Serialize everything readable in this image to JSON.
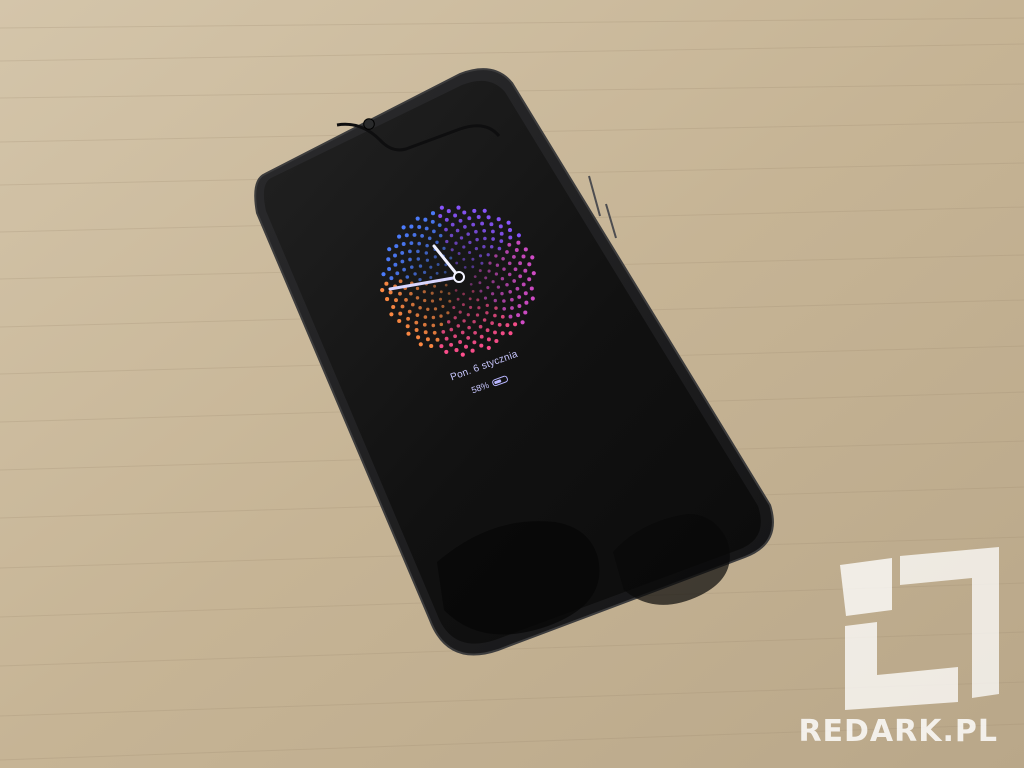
{
  "scene": {
    "surface": "wooden-desk",
    "device": "smartphone-face-up"
  },
  "always_on_display": {
    "date_text": "Pon. 6 stycznia",
    "battery_text": "58%",
    "battery_level": 0.58,
    "clock_hour_hand_angle": 350,
    "clock_minute_hand_angle": 255,
    "accent_color": "#c9c8ff",
    "dot_colors": [
      "#4d7dff",
      "#8a55ff",
      "#d24cc8",
      "#ff4f8d",
      "#ff8a43"
    ]
  },
  "watermark": {
    "text": "REDARK.PL",
    "logo_icon": "redark-logo"
  }
}
